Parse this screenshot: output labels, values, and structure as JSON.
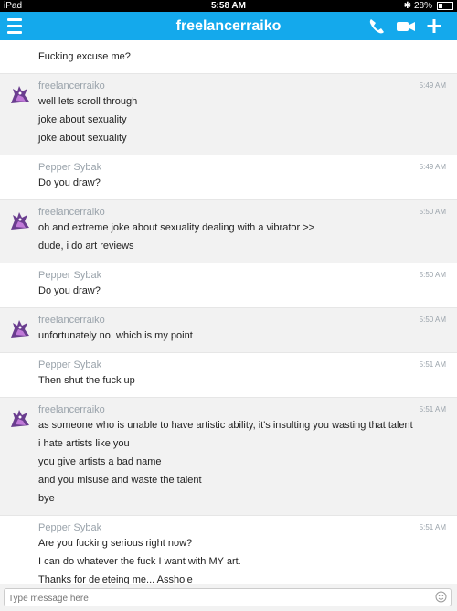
{
  "status_bar": {
    "device": "iPad",
    "time": "5:58 AM",
    "battery_percent": "28%",
    "battery_level": 0.28
  },
  "nav": {
    "title": "freelancerraiko"
  },
  "messages": [
    {
      "sender": "",
      "time": "",
      "lines": [
        "Fucking excuse me?"
      ],
      "avatar": false,
      "alt": false
    },
    {
      "sender": "freelancerraiko",
      "time": "5:49 AM",
      "lines": [
        "well lets scroll through",
        "joke about sexuality",
        "joke about sexuality"
      ],
      "avatar": true,
      "alt": true
    },
    {
      "sender": "Pepper Sybak",
      "time": "5:49 AM",
      "lines": [
        "Do you draw?"
      ],
      "avatar": false,
      "alt": false
    },
    {
      "sender": "freelancerraiko",
      "time": "5:50 AM",
      "lines": [
        "oh and extreme joke about sexuality dealing with a vibrator >>",
        "dude, i do art reviews"
      ],
      "avatar": true,
      "alt": true
    },
    {
      "sender": "Pepper Sybak",
      "time": "5:50 AM",
      "lines": [
        "Do you draw?"
      ],
      "avatar": false,
      "alt": false
    },
    {
      "sender": "freelancerraiko",
      "time": "5:50 AM",
      "lines": [
        "unfortunately no, which is my point"
      ],
      "avatar": true,
      "alt": true
    },
    {
      "sender": "Pepper Sybak",
      "time": "5:51 AM",
      "lines": [
        "Then shut the fuck up"
      ],
      "avatar": false,
      "alt": false
    },
    {
      "sender": "freelancerraiko",
      "time": "5:51 AM",
      "lines": [
        "as someone who is unable to have artistic ability, it's insulting you wasting that talent",
        "i hate artists like you",
        "you give artists a bad name",
        "and you misuse and waste the talent",
        "bye"
      ],
      "avatar": true,
      "alt": true
    },
    {
      "sender": "Pepper Sybak",
      "time": "5:51 AM",
      "lines": [
        "Are you fucking serious right now?",
        "I can do whatever the fuck I want with MY art.",
        "Thanks for deleteing me... Asshole",
        "..."
      ],
      "avatar": false,
      "alt": false
    }
  ],
  "input": {
    "placeholder": "Type message here"
  },
  "colors": {
    "nav_bg": "#14a9ec",
    "alt_row": "#f2f2f2",
    "meta_text": "#9aa3ab"
  },
  "icons": [
    "menu-icon",
    "phone-icon",
    "video-icon",
    "plus-icon",
    "avatar-icon",
    "emoji-icon"
  ]
}
